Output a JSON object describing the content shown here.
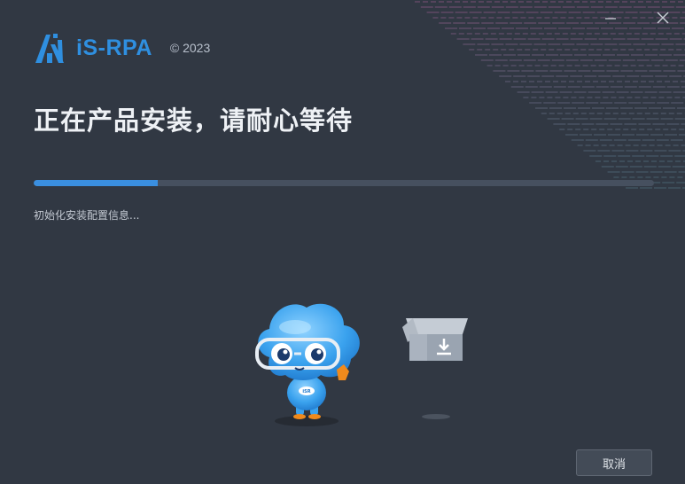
{
  "window": {
    "minimize_icon": "minimize-icon",
    "close_icon": "close-icon"
  },
  "brand": {
    "name": "iS-RPA",
    "copyright": "© 2023",
    "logo_icon": "isrpa-logo-icon",
    "color": "#2f8fe0"
  },
  "install": {
    "headline": "正在产品安装，请耐心等待",
    "progress_fraction": 0.2,
    "status_text": "初始化安装配置信息..."
  },
  "illustration": {
    "mascot": "cloud-mascot-icon",
    "mascot_badge": "iSR",
    "box": "download-box-icon"
  },
  "footer": {
    "cancel_label": "取消"
  },
  "colors": {
    "background": "#313843",
    "accent": "#3a8fe0",
    "track": "#46505f"
  }
}
